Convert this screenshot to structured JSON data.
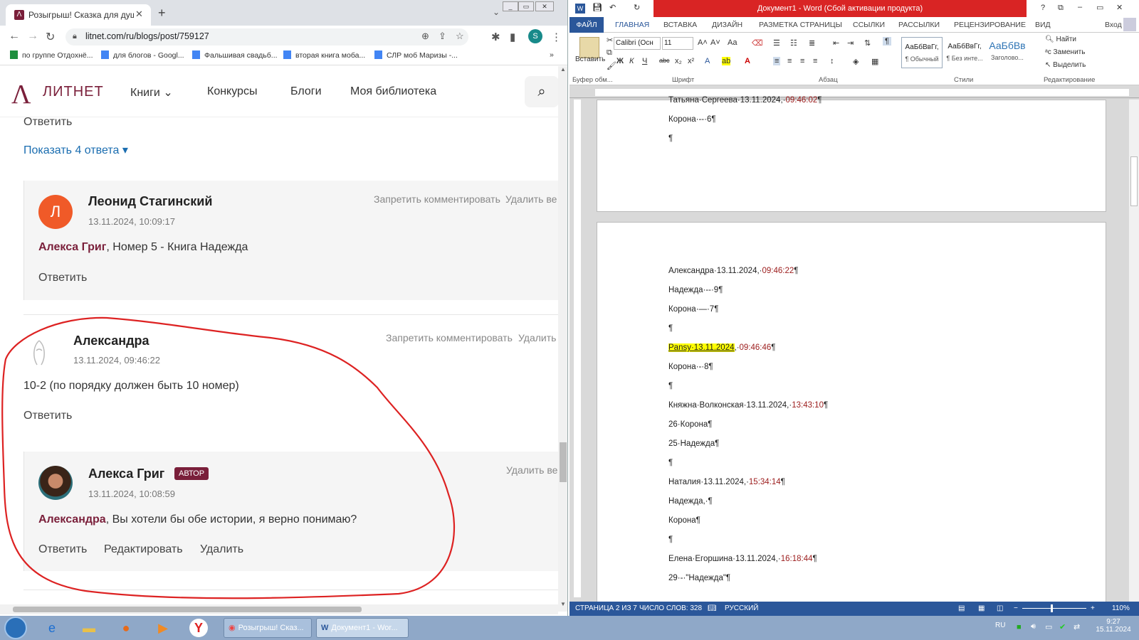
{
  "browser": {
    "tab_title": "Розыгрыш! Сказка для души - Б",
    "url": "litnet.com/ru/blogs/post/759127",
    "bookmarks": [
      "по группе Отдохнё...",
      "для блогов - Googl...",
      "Фальшивая свадьб...",
      "вторая книга моба...",
      "СЛР моб Маризы -..."
    ],
    "profile_letter": "S"
  },
  "site": {
    "logo_text": "ЛИТНЕТ",
    "nav": [
      "Книги",
      "Конкурсы",
      "Блоги",
      "Моя библиотека"
    ]
  },
  "comments": {
    "top_reply": "Ответить",
    "show_replies": "Показать 4 ответа",
    "c1": {
      "avatar": "Л",
      "name": "Леонид Стагинский",
      "date": "13.11.2024, 10:09:17",
      "act1": "Запретить комментировать",
      "act2": "Удалить ве",
      "mention": "Алекса Григ",
      "text": ", Номер 5 - Книга Надежда",
      "reply": "Ответить"
    },
    "c2": {
      "name": "Александра",
      "date": "13.11.2024, 09:46:22",
      "act1": "Запретить комментировать",
      "act2": "Удалить",
      "text": "10-2 (по порядку должен быть 10 номер)",
      "reply": "Ответить"
    },
    "c3": {
      "name": "Алекса Григ",
      "badge": "АВТОР",
      "date": "13.11.2024, 10:08:59",
      "act2": "Удалить ве",
      "mention": "Александра",
      "text": ", Вы хотели бы обе истории, я верно понимаю?",
      "reply": "Ответить",
      "edit": "Редактировать",
      "delete": "Удалить"
    }
  },
  "word": {
    "title": "Документ1 - Word (Сбой активации продукта)",
    "file_tab": "ФАЙЛ",
    "tabs": [
      "ГЛАВНАЯ",
      "ВСТАВКА",
      "ДИЗАЙН",
      "РАЗМЕТКА СТРАНИЦЫ",
      "ССЫЛКИ",
      "РАССЫЛКИ",
      "РЕЦЕНЗИРОВАНИЕ",
      "ВИД"
    ],
    "signin": "Вход",
    "paste": "Вставить",
    "font_name": "Calibri (Осн",
    "font_size": "11",
    "groups": [
      "Буфер обм...",
      "Шрифт",
      "Абзац",
      "Стили",
      "Редактирование"
    ],
    "styles": [
      {
        "sample": "АаБбВвГг,",
        "name": "¶ Обычный"
      },
      {
        "sample": "АаБбВвГг,",
        "name": "¶ Без инте..."
      },
      {
        "sample": "АаБбВв",
        "name": "Заголово..."
      }
    ],
    "find": "Найти",
    "replace": "Заменить",
    "select": "Выделить",
    "page1_lines": [
      {
        "text": "Татьяна·Сергеева·13.11.2024,·",
        "time": "09:46:02",
        "end": "¶"
      },
      {
        "text": "Корона·--·6¶",
        "time": "",
        "end": ""
      },
      {
        "text": "¶",
        "time": "",
        "end": ""
      }
    ],
    "page2_lines": [
      {
        "text": "Александра·13.11.2024,·",
        "time": "09:46:22",
        "end": "¶"
      },
      {
        "text": "Надежда·--·9¶",
        "time": "",
        "end": ""
      },
      {
        "text": "Корона·—·7¶",
        "time": "",
        "end": ""
      },
      {
        "text": "¶",
        "time": "",
        "end": ""
      },
      {
        "hl": "Pansy·13.11.2024",
        "text": ",·",
        "time": "09:46:46",
        "end": "¶"
      },
      {
        "text": "Корона·-·8¶",
        "time": "",
        "end": ""
      },
      {
        "text": "¶",
        "time": "",
        "end": ""
      },
      {
        "text": "Княжна·Волконская·13.11.2024,·",
        "time": "13:43:10",
        "end": "¶"
      },
      {
        "text": "26·Корона¶",
        "time": "",
        "end": ""
      },
      {
        "text": "25·Надежда¶",
        "time": "",
        "end": ""
      },
      {
        "text": "¶",
        "time": "",
        "end": ""
      },
      {
        "text": "Наталия·13.11.2024,·",
        "time": "15:34:14",
        "end": "¶"
      },
      {
        "text": "Надежда,·¶",
        "time": "",
        "end": ""
      },
      {
        "text": "Корона¶",
        "time": "",
        "end": ""
      },
      {
        "text": "¶",
        "time": "",
        "end": ""
      },
      {
        "text": "Елена·Егоршина·13.11.2024,·",
        "time": "16:18:44",
        "end": "¶"
      },
      {
        "text": "29·-·\"Надежда\"¶",
        "time": "",
        "end": ""
      }
    ],
    "status": {
      "page": "СТРАНИЦА 2 ИЗ 7",
      "words": "ЧИСЛО СЛОВ: 328",
      "lang": "РУССКИЙ",
      "zoom": "110%"
    }
  },
  "taskbar": {
    "task1": "Розыгрыш! Сказ...",
    "task2": "Документ1 - Wor...",
    "lang": "RU",
    "time": "9:27",
    "date": "15.11.2024"
  }
}
